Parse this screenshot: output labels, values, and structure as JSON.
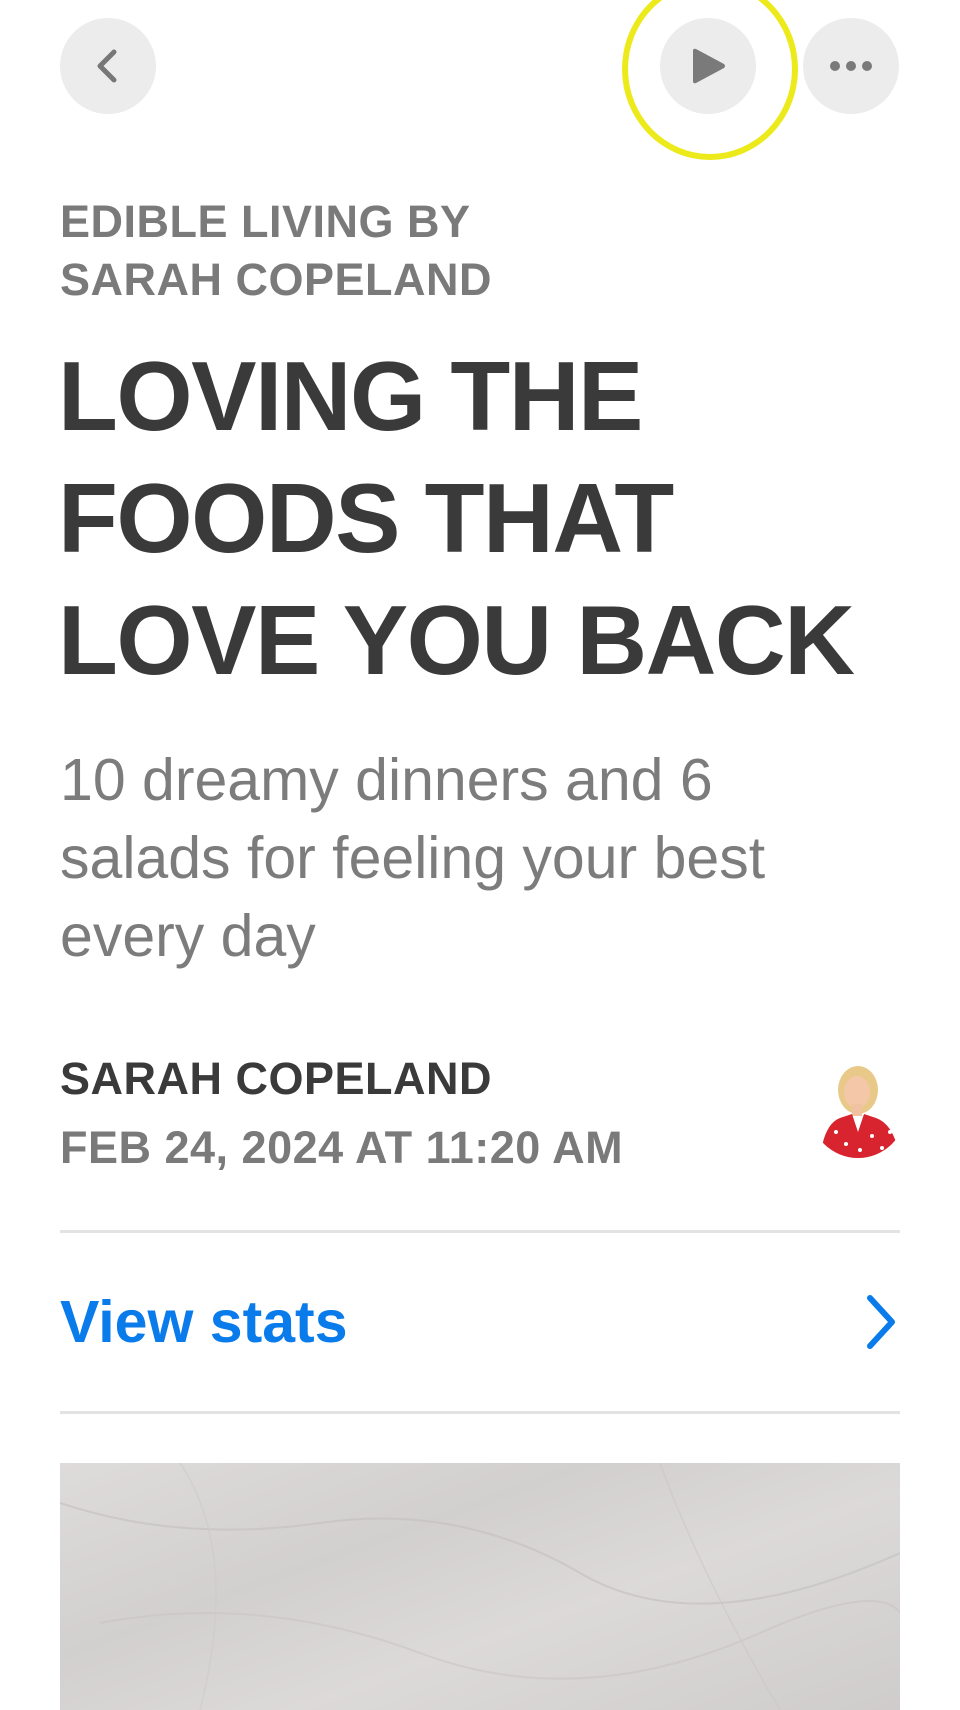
{
  "toolbar": {
    "back_icon": "chevron-left-icon",
    "play_icon": "play-icon",
    "more_icon": "ellipsis-icon"
  },
  "article": {
    "publication": "EDIBLE LIVING BY\nSARAH COPELAND",
    "headline": "LOVING THE\nFOODS THAT\nLOVE YOU BACK",
    "dek": "10 dreamy dinners and 6\nsalads for feeling your best\nevery day",
    "author": "SARAH COPELAND",
    "date": "FEB 24, 2024 AT 11:20 AM"
  },
  "stats": {
    "label": "View stats"
  },
  "colors": {
    "accent": "#0a7bea",
    "highlight": "#ecea1a",
    "headline": "#3a3a3a",
    "secondary": "#7a7a7a"
  }
}
